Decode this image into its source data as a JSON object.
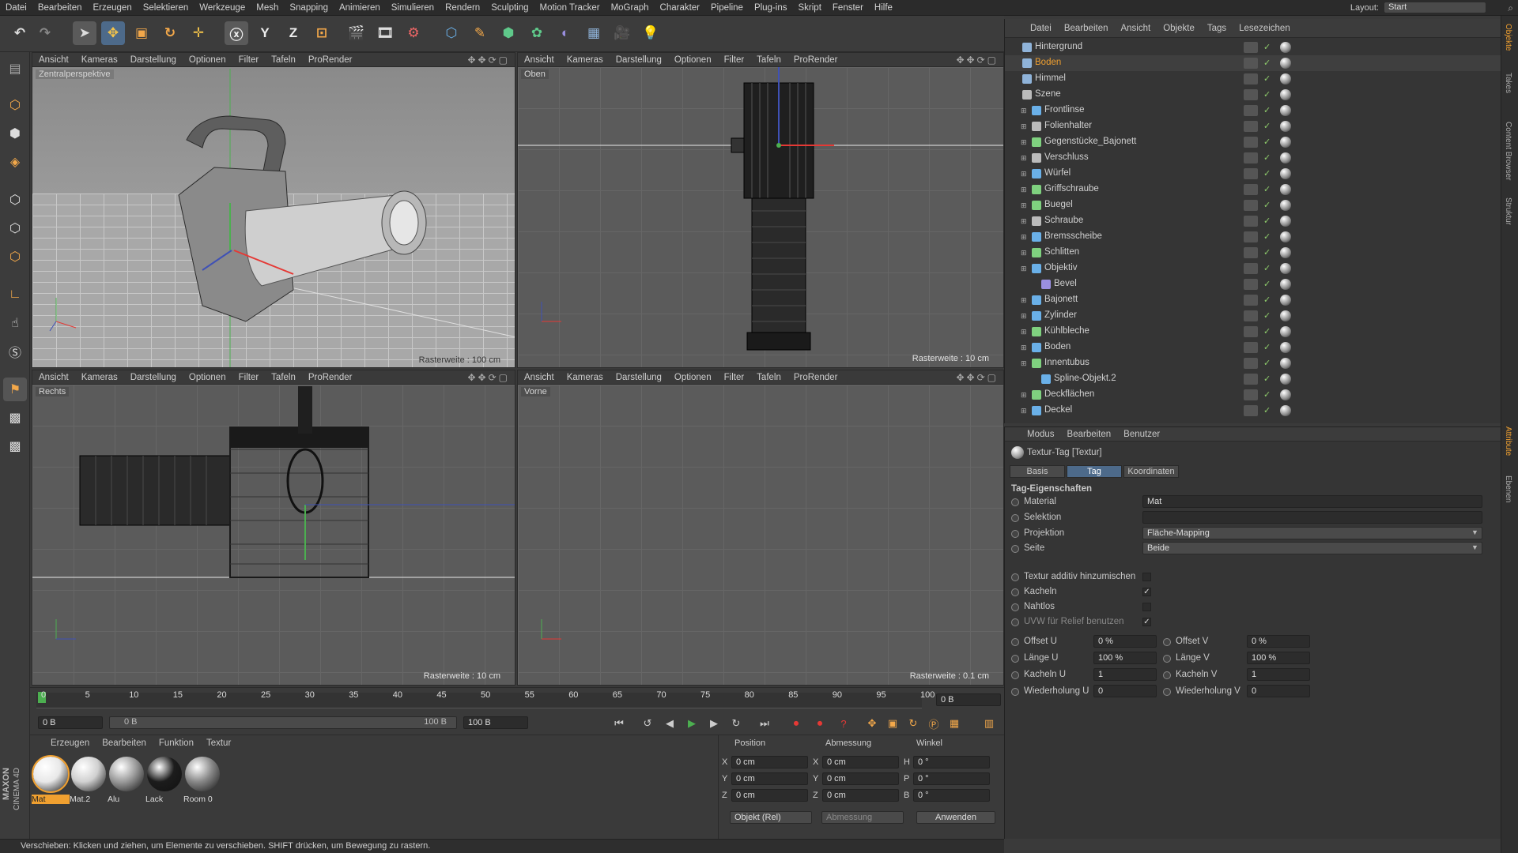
{
  "menubar": {
    "items": [
      "Datei",
      "Bearbeiten",
      "Erzeugen",
      "Selektieren",
      "Werkzeuge",
      "Mesh",
      "Snapping",
      "Animieren",
      "Simulieren",
      "Rendern",
      "Sculpting",
      "Motion Tracker",
      "MoGraph",
      "Charakter",
      "Pipeline",
      "Plug-ins",
      "Skript",
      "Fenster",
      "Hilfe"
    ],
    "layout_label": "Layout:",
    "layout_value": "Start"
  },
  "toolbar": {
    "axis_y": "Y",
    "axis_z": "Z"
  },
  "viewports": [
    {
      "label": "Zentralperspektive",
      "raster": "Rasterweite : 100 cm",
      "menu": [
        "Ansicht",
        "Kameras",
        "Darstellung",
        "Optionen",
        "Filter",
        "Tafeln",
        "ProRender"
      ]
    },
    {
      "label": "Oben",
      "raster": "Rasterweite : 10 cm",
      "menu": [
        "Ansicht",
        "Kameras",
        "Darstellung",
        "Optionen",
        "Filter",
        "Tafeln",
        "ProRender"
      ]
    },
    {
      "label": "Rechts",
      "raster": "Rasterweite : 10 cm",
      "menu": [
        "Ansicht",
        "Kameras",
        "Darstellung",
        "Optionen",
        "Filter",
        "Tafeln",
        "ProRender"
      ]
    },
    {
      "label": "Vorne",
      "raster": "Rasterweite : 0.1 cm",
      "menu": [
        "Ansicht",
        "Kameras",
        "Darstellung",
        "Optionen",
        "Filter",
        "Tafeln",
        "ProRender"
      ]
    }
  ],
  "timeline": {
    "ticks": [
      "0",
      "5",
      "10",
      "15",
      "20",
      "25",
      "30",
      "35",
      "40",
      "45",
      "50",
      "55",
      "60",
      "65",
      "70",
      "75",
      "80",
      "85",
      "90",
      "95",
      "100"
    ],
    "current_frame": "0 B",
    "start_field": "0 B",
    "range_start": "0 B",
    "range_end": "100 B",
    "end_field": "100 B"
  },
  "materials": {
    "menu": [
      "Erzeugen",
      "Bearbeiten",
      "Funktion",
      "Textur"
    ],
    "items": [
      {
        "name": "Mat",
        "color": "#e8e8e8",
        "active": true
      },
      {
        "name": "Mat.2",
        "color": "#d0d0d0",
        "active": false
      },
      {
        "name": "Alu",
        "color": "#9a9a9a",
        "active": false
      },
      {
        "name": "Lack",
        "color": "#1c1c1c",
        "active": false
      },
      {
        "name": "Room 0",
        "color": "#888888",
        "active": false
      }
    ]
  },
  "coords": {
    "headers": [
      "Position",
      "Abmessung",
      "Winkel"
    ],
    "rows": [
      {
        "a": "X",
        "pos": "0 cm",
        "b": "X",
        "size": "0 cm",
        "c": "H",
        "rot": "0 °"
      },
      {
        "a": "Y",
        "pos": "0 cm",
        "b": "Y",
        "size": "0 cm",
        "c": "P",
        "rot": "0 °"
      },
      {
        "a": "Z",
        "pos": "0 cm",
        "b": "Z",
        "size": "0 cm",
        "c": "B",
        "rot": "0 °"
      }
    ],
    "mode": "Objekt (Rel)",
    "size_mode": "Abmessung",
    "apply": "Anwenden"
  },
  "status": "Verschieben: Klicken und ziehen, um Elemente zu verschieben. SHIFT drücken, um Bewegung zu rastern.",
  "brand": {
    "line1": "MAXON",
    "line2": "CINEMA 4D"
  },
  "objects": {
    "menu": [
      "Datei",
      "Bearbeiten",
      "Ansicht",
      "Objekte",
      "Tags",
      "Lesezeichen"
    ],
    "items": [
      {
        "name": "Hintergrund",
        "indent": 0,
        "color": "#8fb3d9",
        "sel": false
      },
      {
        "name": "Boden",
        "indent": 0,
        "color": "#8fb3d9",
        "sel": true
      },
      {
        "name": "Himmel",
        "indent": 0,
        "color": "#8fb3d9",
        "sel": false
      },
      {
        "name": "Szene",
        "indent": 0,
        "color": "#bbbbbb",
        "sel": false
      },
      {
        "name": "Frontlinse",
        "indent": 1,
        "color": "#6ab0e8",
        "sel": false
      },
      {
        "name": "Folienhalter",
        "indent": 1,
        "color": "#bbbbbb",
        "sel": false
      },
      {
        "name": "Gegenstücke_Bajonett",
        "indent": 1,
        "color": "#7fd17f",
        "sel": false
      },
      {
        "name": "Verschluss",
        "indent": 1,
        "color": "#bbbbbb",
        "sel": false
      },
      {
        "name": "Würfel",
        "indent": 1,
        "color": "#6ab0e8",
        "sel": false
      },
      {
        "name": "Griffschraube",
        "indent": 1,
        "color": "#7fd17f",
        "sel": false
      },
      {
        "name": "Buegel",
        "indent": 1,
        "color": "#7fd17f",
        "sel": false
      },
      {
        "name": "Schraube",
        "indent": 1,
        "color": "#bbbbbb",
        "sel": false
      },
      {
        "name": "Bremsscheibe",
        "indent": 1,
        "color": "#6ab0e8",
        "sel": false
      },
      {
        "name": "Schlitten",
        "indent": 1,
        "color": "#7fd17f",
        "sel": false
      },
      {
        "name": "Objektiv",
        "indent": 1,
        "color": "#6ab0e8",
        "sel": false
      },
      {
        "name": "Bevel",
        "indent": 2,
        "color": "#9a8fe0",
        "sel": false
      },
      {
        "name": "Bajonett",
        "indent": 1,
        "color": "#6ab0e8",
        "sel": false
      },
      {
        "name": "Zylinder",
        "indent": 1,
        "color": "#6ab0e8",
        "sel": false
      },
      {
        "name": "Kühlbleche",
        "indent": 1,
        "color": "#7fd17f",
        "sel": false
      },
      {
        "name": "Boden",
        "indent": 1,
        "color": "#6ab0e8",
        "sel": false
      },
      {
        "name": "Innentubus",
        "indent": 1,
        "color": "#7fd17f",
        "sel": false
      },
      {
        "name": "Spline-Objekt.2",
        "indent": 2,
        "color": "#6ab0e8",
        "sel": false
      },
      {
        "name": "Deckflächen",
        "indent": 1,
        "color": "#7fd17f",
        "sel": false
      },
      {
        "name": "Deckel",
        "indent": 1,
        "color": "#6ab0e8",
        "sel": false
      }
    ]
  },
  "attributes": {
    "menu": [
      "Modus",
      "Bearbeiten",
      "Benutzer"
    ],
    "title": "Textur-Tag [Textur]",
    "tabs": [
      {
        "label": "Basis",
        "active": false
      },
      {
        "label": "Tag",
        "active": true
      },
      {
        "label": "Koordinaten",
        "active": false
      }
    ],
    "section": "Tag-Eigenschaften",
    "material_label": "Material",
    "material_value": "Mat",
    "selektion_label": "Selektion",
    "selektion_value": "",
    "projektion_label": "Projektion",
    "projektion_value": "Fläche-Mapping",
    "seite_label": "Seite",
    "seite_value": "Beide",
    "checks": [
      {
        "label": "Textur additiv hinzumischen",
        "checked": false,
        "dim": false
      },
      {
        "label": "Kacheln",
        "checked": true,
        "dim": false
      },
      {
        "label": "Nahtlos",
        "checked": false,
        "dim": false
      },
      {
        "label": "UVW für Relief benutzen",
        "checked": true,
        "dim": true
      }
    ],
    "pairs": [
      {
        "l1": "Offset U",
        "v1": "0 %",
        "l2": "Offset V",
        "v2": "0 %"
      },
      {
        "l1": "Länge U",
        "v1": "100 %",
        "l2": "Länge V",
        "v2": "100 %"
      },
      {
        "l1": "Kacheln U",
        "v1": "1",
        "l2": "Kacheln V",
        "v2": "1"
      },
      {
        "l1": "Wiederholung U",
        "v1": "0",
        "l2": "Wiederholung V",
        "v2": "0"
      }
    ]
  },
  "right_tabs": [
    "Objekte",
    "Takes",
    "Content Browser",
    "Struktur",
    "Attribute",
    "Ebenen"
  ]
}
